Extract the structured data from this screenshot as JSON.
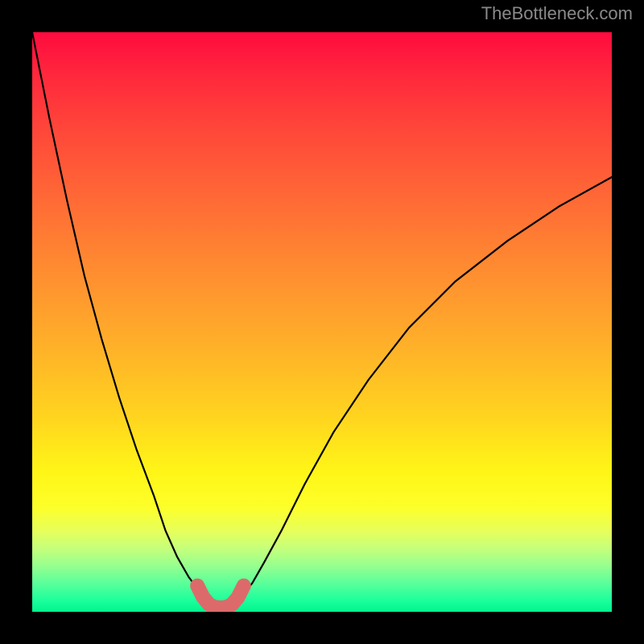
{
  "watermark": "TheBottleneck.com",
  "chart_data": {
    "type": "line",
    "title": "",
    "xlabel": "",
    "ylabel": "",
    "xlim": [
      0,
      100
    ],
    "ylim": [
      0,
      100
    ],
    "grid": false,
    "legend": false,
    "series": [
      {
        "name": "curve-left",
        "x": [
          0,
          3,
          6,
          9,
          12,
          15,
          18,
          21,
          23,
          25,
          27,
          28.5,
          29.5,
          30.5,
          31.5
        ],
        "values": [
          100,
          85,
          71,
          58,
          47,
          37,
          28,
          20,
          14,
          9.5,
          6,
          4,
          2.5,
          1.5,
          1.0
        ]
      },
      {
        "name": "curve-right",
        "x": [
          34.5,
          36,
          38,
          40,
          43,
          47,
          52,
          58,
          65,
          73,
          82,
          91,
          100
        ],
        "values": [
          1.0,
          2.5,
          5,
          8.5,
          14,
          22,
          31,
          40,
          49,
          57,
          64,
          70,
          75
        ]
      },
      {
        "name": "highlight-band",
        "x": [
          28.5,
          29.5,
          30.5,
          31.5,
          32.5,
          33.5,
          34.5,
          35.5,
          36.5
        ],
        "values": [
          4.5,
          2.5,
          1.3,
          0.8,
          0.7,
          0.8,
          1.3,
          2.5,
          4.5
        ]
      }
    ],
    "colors": {
      "curve": "#000000",
      "highlight": "#dd6a6a"
    }
  }
}
